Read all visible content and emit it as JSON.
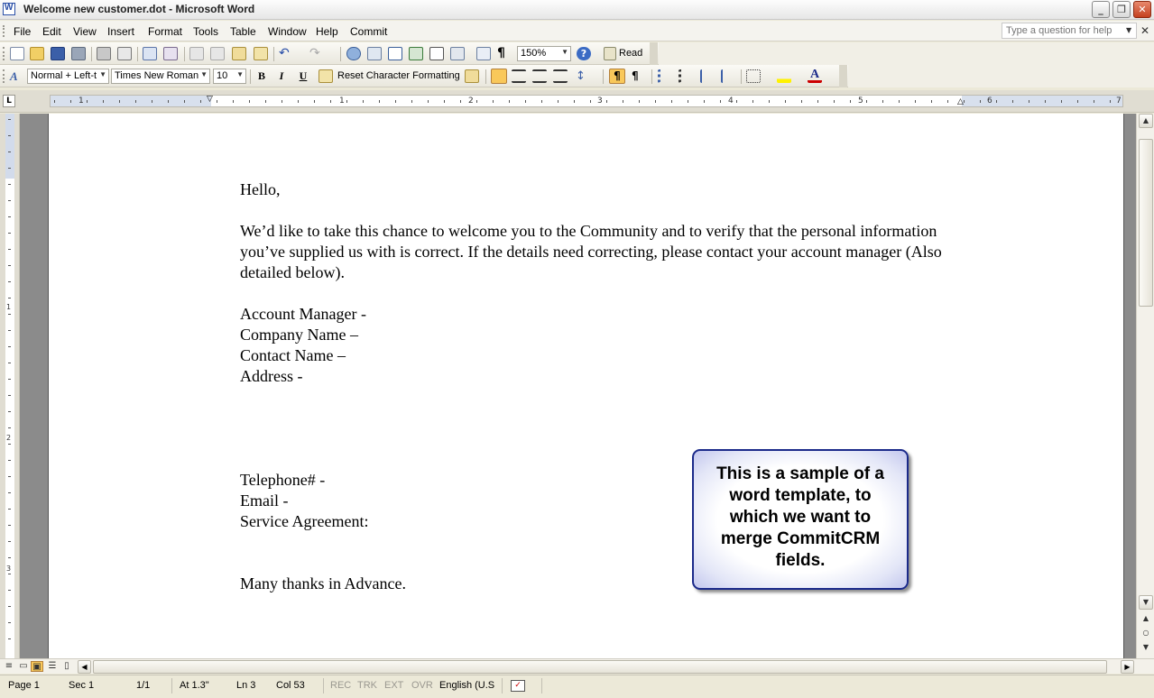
{
  "window": {
    "title": "Welcome new customer.dot - Microsoft Word",
    "minimize": "_",
    "restore": "❐",
    "close": "✕"
  },
  "menu": {
    "items": [
      "File",
      "Edit",
      "View",
      "Insert",
      "Format",
      "Tools",
      "Table",
      "Window",
      "Help",
      "Commit"
    ],
    "help_placeholder": "Type a question for help",
    "close": "✕"
  },
  "standard_toolbar": {
    "zoom": "150%",
    "read_label": "Read"
  },
  "formatting_toolbar": {
    "style": "Normal + Left-t",
    "font": "Times New Roman",
    "size": "10",
    "bold": "B",
    "italic": "I",
    "underline": "U",
    "reset_label": "Reset Character Formatting",
    "active_alignment": "left"
  },
  "ruler": {
    "corner": "L",
    "labels": [
      "1",
      "1",
      "2",
      "3",
      "4",
      "5",
      "6",
      "7"
    ],
    "vertical_labels": [
      "1",
      "2",
      "3"
    ]
  },
  "document": {
    "greeting": "Hello,",
    "paragraph": "We’d like to take this chance to welcome you to the Community and to verify that the personal information you’ve supplied us with is correct. If the details need correcting, please contact your account manager (Also detailed below).",
    "fields": [
      "Account Manager -",
      "Company Name –",
      "Contact Name –",
      "Address -"
    ],
    "fields2": [
      "Telephone# -",
      "Email -",
      "Service Agreement:"
    ],
    "closing": "Many thanks in Advance."
  },
  "callout": {
    "text": "This is a sample of a word template, to which we want to merge CommitCRM fields."
  },
  "statusbar": {
    "page": "Page  1",
    "sec": "Sec  1",
    "pages": "1/1",
    "at": "At  1.3\"",
    "ln": "Ln  3",
    "col": "Col  53",
    "rec": "REC",
    "trk": "TRK",
    "ext": "EXT",
    "ovr": "OVR",
    "language": "English (U.S"
  },
  "colors": {
    "toolbar_active": "#f9c85a",
    "callout_border": "#1b2a8a"
  }
}
